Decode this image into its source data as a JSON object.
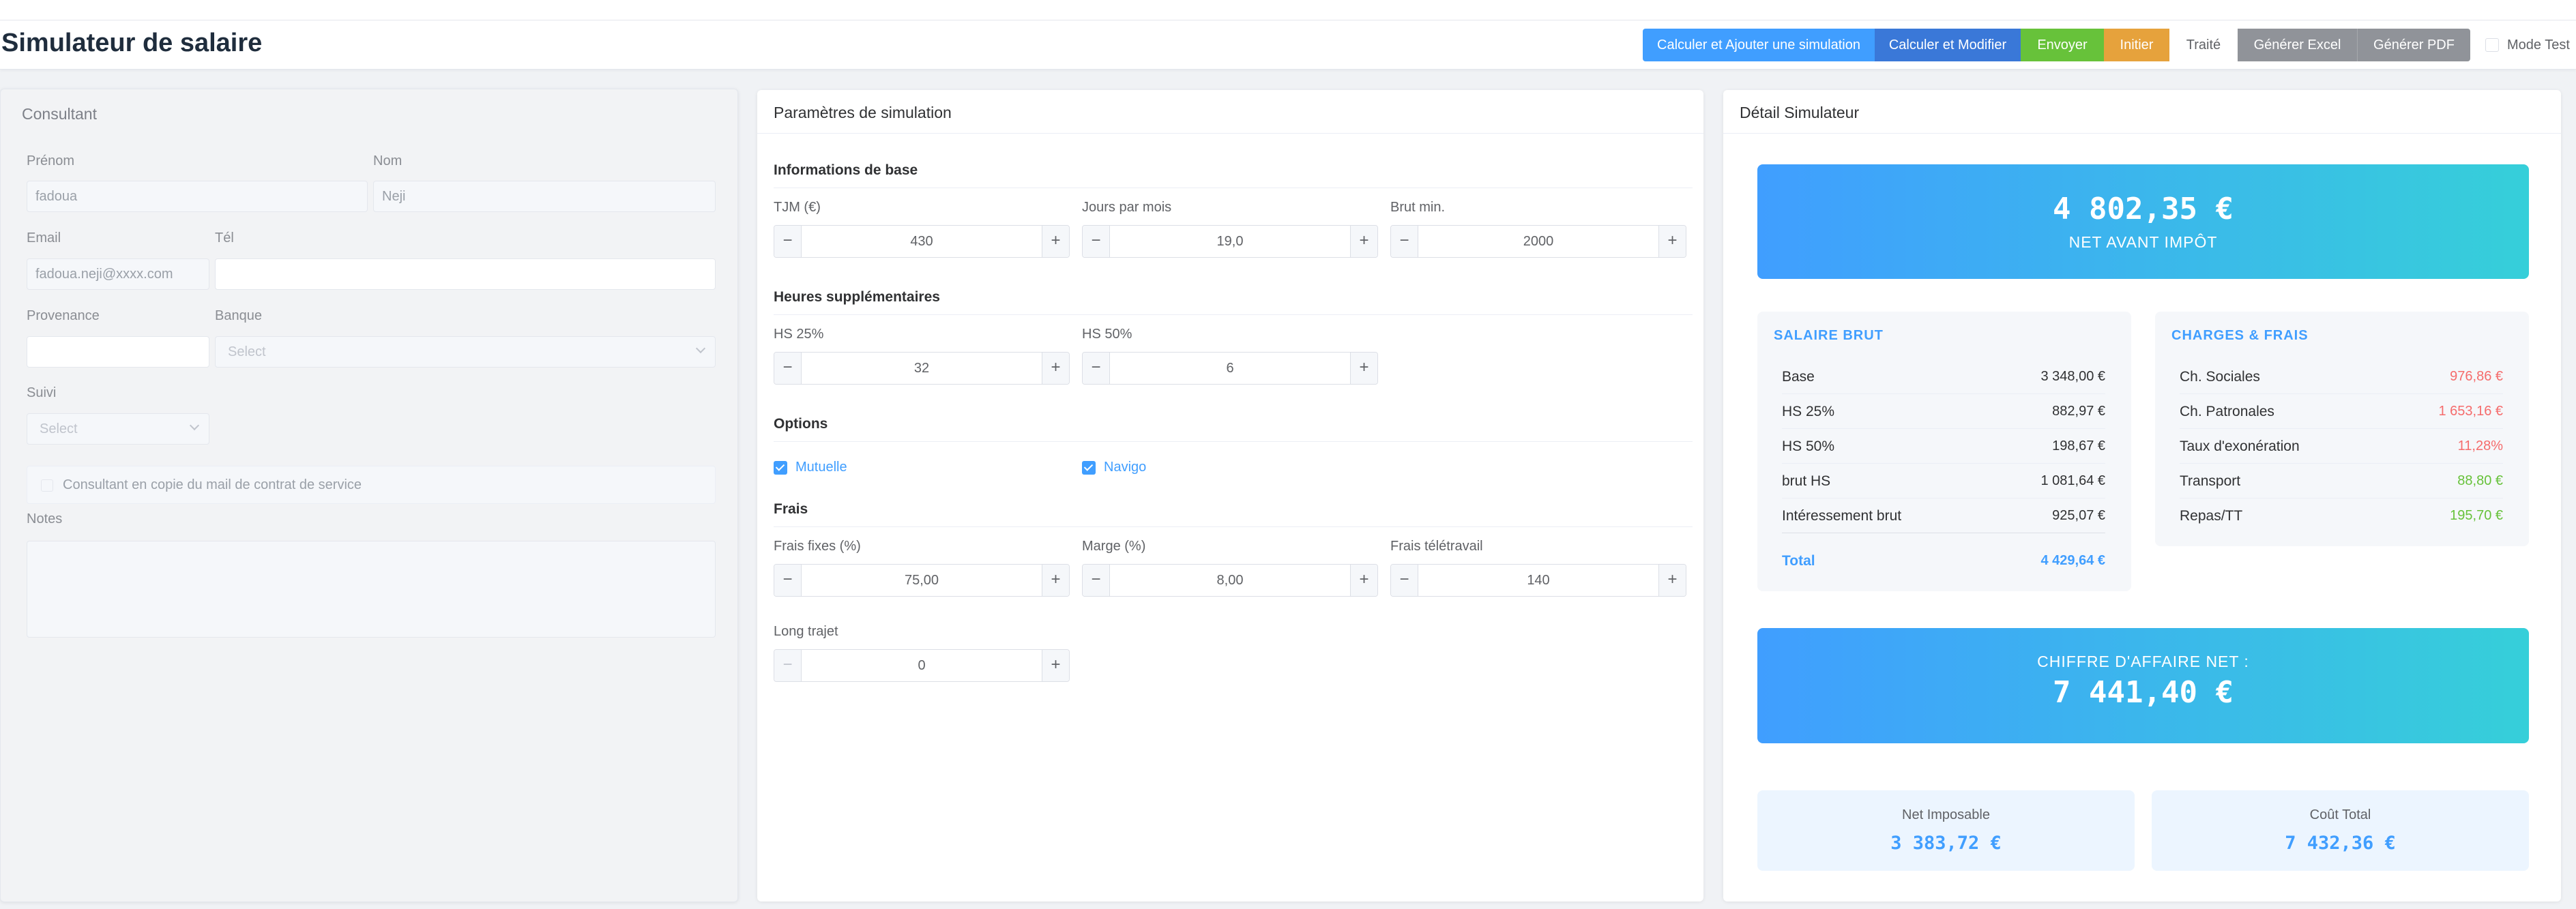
{
  "header": {
    "title": "Simulateur de salaire"
  },
  "toolbar": {
    "calc_add": "Calculer et Ajouter une simulation",
    "calc_modify": "Calculer et Modifier",
    "send": "Envoyer",
    "init": "Initier",
    "treated": "Traité",
    "excel": "Générer Excel",
    "pdf": "Générer PDF",
    "mode_test": "Mode Test"
  },
  "consultant": {
    "title": "Consultant",
    "prenom_label": "Prénom",
    "prenom_value": "fadoua",
    "nom_label": "Nom",
    "nom_value": "Neji",
    "email_label": "Email",
    "email_value": "fadoua.neji@xxxx.com",
    "tel_label": "Tél",
    "tel_value": "",
    "provenance_label": "Provenance",
    "provenance_value": "",
    "banque_label": "Banque",
    "banque_placeholder": "Select",
    "suivi_label": "Suivi",
    "suivi_placeholder": "Select",
    "copy_label": "Consultant en copie du mail de contrat de service",
    "notes_label": "Notes"
  },
  "params": {
    "title": "Paramètres de simulation",
    "base_title": "Informations de base",
    "tjm_label": "TJM (€)",
    "tjm_value": "430",
    "jours_label": "Jours par mois",
    "jours_value": "19,0",
    "brut_label": "Brut min.",
    "brut_value": "2000",
    "hs_title": "Heures supplémentaires",
    "hs25_label": "HS 25%",
    "hs25_value": "32",
    "hs50_label": "HS 50%",
    "hs50_value": "6",
    "options_title": "Options",
    "mutuelle": "Mutuelle",
    "navigo": "Navigo",
    "frais_title": "Frais",
    "fixes_label": "Frais fixes (%)",
    "fixes_value": "75,00",
    "marge_label": "Marge (%)",
    "marge_value": "8,00",
    "tele_label": "Frais télétravail",
    "tele_value": "140",
    "trajet_label": "Long trajet",
    "trajet_value": "0"
  },
  "detail": {
    "title": "Détail Simulateur",
    "net_value": "4 802,35 €",
    "net_label": "NET AVANT IMPÔT",
    "brut_title": "SALAIRE BRUT",
    "brut_rows": [
      {
        "label": "Base",
        "value": "3 348,00 €"
      },
      {
        "label": "HS 25%",
        "value": "882,97 €"
      },
      {
        "label": "HS 50%",
        "value": "198,67 €"
      },
      {
        "label": "brut HS",
        "value": "1 081,64 €"
      },
      {
        "label": "Intéressement brut",
        "value": "925,07 €"
      }
    ],
    "total_label": "Total",
    "total_value": "4 429,64 €",
    "charges_title": "CHARGES & FRAIS",
    "charges_rows": [
      {
        "label": "Ch. Sociales",
        "value": "976,86 €",
        "color": "#f56c6c"
      },
      {
        "label": "Ch. Patronales",
        "value": "1 653,16 €",
        "color": "#f56c6c"
      },
      {
        "label": "Taux d'exonération",
        "value": "11,28%",
        "color": "#f56c6c"
      },
      {
        "label": "Transport",
        "value": "88,80 €",
        "color": "#67c23a"
      },
      {
        "label": "Repas/TT",
        "value": "195,70 €",
        "color": "#67c23a"
      }
    ],
    "ca_label": "CHIFFRE D'AFFAIRE NET :",
    "ca_value": "7 441,40 €",
    "imposable_label": "Net Imposable",
    "imposable_value": "3 383,72 €",
    "cout_label": "Coût Total",
    "cout_value": "7 432,36 €"
  }
}
